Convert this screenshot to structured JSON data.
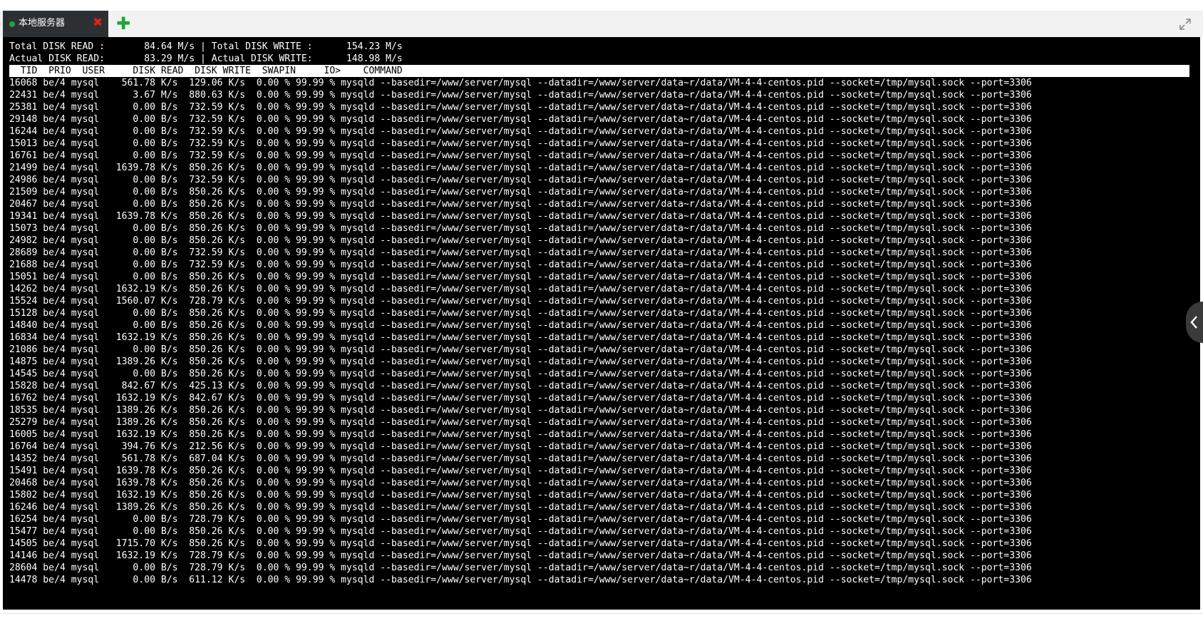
{
  "tab": {
    "label": "本地服务器",
    "status_color": "#20a53a",
    "close_icon": "close-icon",
    "close_color": "#e02020",
    "close_glyph": "✖"
  },
  "add_tab": {
    "icon": "plus-icon",
    "glyph": "✚",
    "color": "#20a53a"
  },
  "fullscreen": {
    "icon": "expand-icon"
  },
  "side_panel": {
    "icon": "chevron-left-icon"
  },
  "terminal": {
    "summary": [
      "Total DISK READ :       84.64 M/s | Total DISK WRITE :      154.23 M/s",
      "Actual DISK READ:       83.29 M/s | Actual DISK WRITE:      148.98 M/s"
    ],
    "header": "  TID  PRIO  USER     DISK READ  DISK WRITE  SWAPIN     IO>    COMMAND",
    "rows": [
      "16068 be/4 mysql    561.78 K/s  129.06 K/s  0.00 % 99.99 % mysqld --basedir=/www/server/mysql --datadir=/www/server/data~r/data/VM-4-4-centos.pid --socket=/tmp/mysql.sock --port=3306",
      "22431 be/4 mysql      3.67 M/s  880.63 K/s  0.00 % 99.99 % mysqld --basedir=/www/server/mysql --datadir=/www/server/data~r/data/VM-4-4-centos.pid --socket=/tmp/mysql.sock --port=3306",
      "25381 be/4 mysql      0.00 B/s  732.59 K/s  0.00 % 99.99 % mysqld --basedir=/www/server/mysql --datadir=/www/server/data~r/data/VM-4-4-centos.pid --socket=/tmp/mysql.sock --port=3306",
      "29148 be/4 mysql      0.00 B/s  732.59 K/s  0.00 % 99.99 % mysqld --basedir=/www/server/mysql --datadir=/www/server/data~r/data/VM-4-4-centos.pid --socket=/tmp/mysql.sock --port=3306",
      "16244 be/4 mysql      0.00 B/s  732.59 K/s  0.00 % 99.99 % mysqld --basedir=/www/server/mysql --datadir=/www/server/data~r/data/VM-4-4-centos.pid --socket=/tmp/mysql.sock --port=3306",
      "15013 be/4 mysql      0.00 B/s  732.59 K/s  0.00 % 99.99 % mysqld --basedir=/www/server/mysql --datadir=/www/server/data~r/data/VM-4-4-centos.pid --socket=/tmp/mysql.sock --port=3306",
      "16761 be/4 mysql      0.00 B/s  732.59 K/s  0.00 % 99.99 % mysqld --basedir=/www/server/mysql --datadir=/www/server/data~r/data/VM-4-4-centos.pid --socket=/tmp/mysql.sock --port=3306",
      "21499 be/4 mysql   1639.78 K/s  850.26 K/s  0.00 % 99.99 % mysqld --basedir=/www/server/mysql --datadir=/www/server/data~r/data/VM-4-4-centos.pid --socket=/tmp/mysql.sock --port=3306",
      "24986 be/4 mysql      0.00 B/s  732.59 K/s  0.00 % 99.99 % mysqld --basedir=/www/server/mysql --datadir=/www/server/data~r/data/VM-4-4-centos.pid --socket=/tmp/mysql.sock --port=3306",
      "21509 be/4 mysql      0.00 B/s  850.26 K/s  0.00 % 99.99 % mysqld --basedir=/www/server/mysql --datadir=/www/server/data~r/data/VM-4-4-centos.pid --socket=/tmp/mysql.sock --port=3306",
      "20467 be/4 mysql      0.00 B/s  850.26 K/s  0.00 % 99.99 % mysqld --basedir=/www/server/mysql --datadir=/www/server/data~r/data/VM-4-4-centos.pid --socket=/tmp/mysql.sock --port=3306",
      "19341 be/4 mysql   1639.78 K/s  850.26 K/s  0.00 % 99.99 % mysqld --basedir=/www/server/mysql --datadir=/www/server/data~r/data/VM-4-4-centos.pid --socket=/tmp/mysql.sock --port=3306",
      "15073 be/4 mysql      0.00 B/s  850.26 K/s  0.00 % 99.99 % mysqld --basedir=/www/server/mysql --datadir=/www/server/data~r/data/VM-4-4-centos.pid --socket=/tmp/mysql.sock --port=3306",
      "24982 be/4 mysql      0.00 B/s  850.26 K/s  0.00 % 99.99 % mysqld --basedir=/www/server/mysql --datadir=/www/server/data~r/data/VM-4-4-centos.pid --socket=/tmp/mysql.sock --port=3306",
      "28689 be/4 mysql      0.00 B/s  732.59 K/s  0.00 % 99.99 % mysqld --basedir=/www/server/mysql --datadir=/www/server/data~r/data/VM-4-4-centos.pid --socket=/tmp/mysql.sock --port=3306",
      "21688 be/4 mysql      0.00 B/s  732.59 K/s  0.00 % 99.99 % mysqld --basedir=/www/server/mysql --datadir=/www/server/data~r/data/VM-4-4-centos.pid --socket=/tmp/mysql.sock --port=3306",
      "15051 be/4 mysql      0.00 B/s  850.26 K/s  0.00 % 99.99 % mysqld --basedir=/www/server/mysql --datadir=/www/server/data~r/data/VM-4-4-centos.pid --socket=/tmp/mysql.sock --port=3306",
      "14262 be/4 mysql   1632.19 K/s  850.26 K/s  0.00 % 99.99 % mysqld --basedir=/www/server/mysql --datadir=/www/server/data~r/data/VM-4-4-centos.pid --socket=/tmp/mysql.sock --port=3306",
      "15524 be/4 mysql   1560.07 K/s  728.79 K/s  0.00 % 99.99 % mysqld --basedir=/www/server/mysql --datadir=/www/server/data~r/data/VM-4-4-centos.pid --socket=/tmp/mysql.sock --port=3306",
      "15128 be/4 mysql      0.00 B/s  850.26 K/s  0.00 % 99.99 % mysqld --basedir=/www/server/mysql --datadir=/www/server/data~r/data/VM-4-4-centos.pid --socket=/tmp/mysql.sock --port=3306",
      "14840 be/4 mysql      0.00 B/s  850.26 K/s  0.00 % 99.99 % mysqld --basedir=/www/server/mysql --datadir=/www/server/data~r/data/VM-4-4-centos.pid --socket=/tmp/mysql.sock --port=3306",
      "16834 be/4 mysql   1632.19 K/s  850.26 K/s  0.00 % 99.99 % mysqld --basedir=/www/server/mysql --datadir=/www/server/data~r/data/VM-4-4-centos.pid --socket=/tmp/mysql.sock --port=3306",
      "21086 be/4 mysql      0.00 B/s  850.26 K/s  0.00 % 99.99 % mysqld --basedir=/www/server/mysql --datadir=/www/server/data~r/data/VM-4-4-centos.pid --socket=/tmp/mysql.sock --port=3306",
      "14875 be/4 mysql   1389.26 K/s  850.26 K/s  0.00 % 99.99 % mysqld --basedir=/www/server/mysql --datadir=/www/server/data~r/data/VM-4-4-centos.pid --socket=/tmp/mysql.sock --port=3306",
      "14545 be/4 mysql      0.00 B/s  850.26 K/s  0.00 % 99.99 % mysqld --basedir=/www/server/mysql --datadir=/www/server/data~r/data/VM-4-4-centos.pid --socket=/tmp/mysql.sock --port=3306",
      "15828 be/4 mysql    842.67 K/s  425.13 K/s  0.00 % 99.99 % mysqld --basedir=/www/server/mysql --datadir=/www/server/data~r/data/VM-4-4-centos.pid --socket=/tmp/mysql.sock --port=3306",
      "16762 be/4 mysql   1632.19 K/s  842.67 K/s  0.00 % 99.99 % mysqld --basedir=/www/server/mysql --datadir=/www/server/data~r/data/VM-4-4-centos.pid --socket=/tmp/mysql.sock --port=3306",
      "18535 be/4 mysql   1389.26 K/s  850.26 K/s  0.00 % 99.99 % mysqld --basedir=/www/server/mysql --datadir=/www/server/data~r/data/VM-4-4-centos.pid --socket=/tmp/mysql.sock --port=3306",
      "25279 be/4 mysql   1389.26 K/s  850.26 K/s  0.00 % 99.99 % mysqld --basedir=/www/server/mysql --datadir=/www/server/data~r/data/VM-4-4-centos.pid --socket=/tmp/mysql.sock --port=3306",
      "16005 be/4 mysql   1632.19 K/s  850.26 K/s  0.00 % 99.99 % mysqld --basedir=/www/server/mysql --datadir=/www/server/data~r/data/VM-4-4-centos.pid --socket=/tmp/mysql.sock --port=3306",
      "16764 be/4 mysql    394.76 K/s  212.56 K/s  0.00 % 99.99 % mysqld --basedir=/www/server/mysql --datadir=/www/server/data~r/data/VM-4-4-centos.pid --socket=/tmp/mysql.sock --port=3306",
      "14352 be/4 mysql    561.78 K/s  687.04 K/s  0.00 % 99.99 % mysqld --basedir=/www/server/mysql --datadir=/www/server/data~r/data/VM-4-4-centos.pid --socket=/tmp/mysql.sock --port=3306",
      "15491 be/4 mysql   1639.78 K/s  850.26 K/s  0.00 % 99.99 % mysqld --basedir=/www/server/mysql --datadir=/www/server/data~r/data/VM-4-4-centos.pid --socket=/tmp/mysql.sock --port=3306",
      "20468 be/4 mysql   1639.78 K/s  850.26 K/s  0.00 % 99.99 % mysqld --basedir=/www/server/mysql --datadir=/www/server/data~r/data/VM-4-4-centos.pid --socket=/tmp/mysql.sock --port=3306",
      "15802 be/4 mysql   1632.19 K/s  850.26 K/s  0.00 % 99.99 % mysqld --basedir=/www/server/mysql --datadir=/www/server/data~r/data/VM-4-4-centos.pid --socket=/tmp/mysql.sock --port=3306",
      "16246 be/4 mysql   1389.26 K/s  850.26 K/s  0.00 % 99.99 % mysqld --basedir=/www/server/mysql --datadir=/www/server/data~r/data/VM-4-4-centos.pid --socket=/tmp/mysql.sock --port=3306",
      "16254 be/4 mysql      0.00 B/s  728.79 K/s  0.00 % 99.99 % mysqld --basedir=/www/server/mysql --datadir=/www/server/data~r/data/VM-4-4-centos.pid --socket=/tmp/mysql.sock --port=3306",
      "15477 be/4 mysql      0.00 B/s  850.26 K/s  0.00 % 99.99 % mysqld --basedir=/www/server/mysql --datadir=/www/server/data~r/data/VM-4-4-centos.pid --socket=/tmp/mysql.sock --port=3306",
      "14505 be/4 mysql   1715.70 K/s  850.26 K/s  0.00 % 99.99 % mysqld --basedir=/www/server/mysql --datadir=/www/server/data~r/data/VM-4-4-centos.pid --socket=/tmp/mysql.sock --port=3306",
      "14146 be/4 mysql   1632.19 K/s  728.79 K/s  0.00 % 99.99 % mysqld --basedir=/www/server/mysql --datadir=/www/server/data~r/data/VM-4-4-centos.pid --socket=/tmp/mysql.sock --port=3306",
      "28604 be/4 mysql      0.00 B/s  728.79 K/s  0.00 % 99.99 % mysqld --basedir=/www/server/mysql --datadir=/www/server/data~r/data/VM-4-4-centos.pid --socket=/tmp/mysql.sock --port=3306",
      "14478 be/4 mysql      0.00 B/s  611.12 K/s  0.00 % 99.99 % mysqld --basedir=/www/server/mysql --datadir=/www/server/data~r/data/VM-4-4-centos.pid --socket=/tmp/mysql.sock --port=3306"
    ]
  }
}
